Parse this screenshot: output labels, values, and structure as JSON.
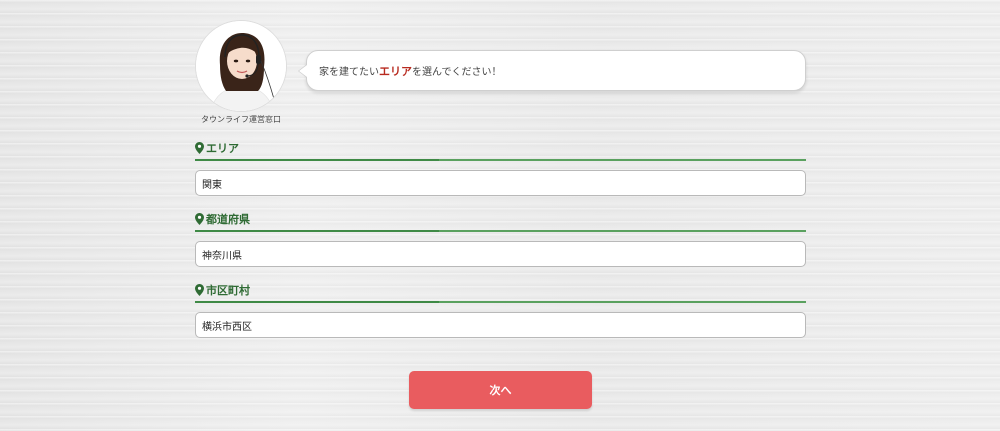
{
  "operator": {
    "caption": "タウンライフ運営窓口"
  },
  "bubble": {
    "text_before": "家を建てたい",
    "text_highlight": "エリア",
    "text_after": "を選んでください！"
  },
  "fields": [
    {
      "label": "エリア",
      "value": "関東"
    },
    {
      "label": "都道府県",
      "value": "神奈川県"
    },
    {
      "label": "市区町村",
      "value": "横浜市西区"
    }
  ],
  "next_button": {
    "label": "次へ"
  },
  "colors": {
    "accent_green": "#2f6b34",
    "highlight_red": "#b82a1f",
    "button_red": "#e95c5f"
  },
  "icons": {
    "field_marker": "map-pin-icon"
  }
}
